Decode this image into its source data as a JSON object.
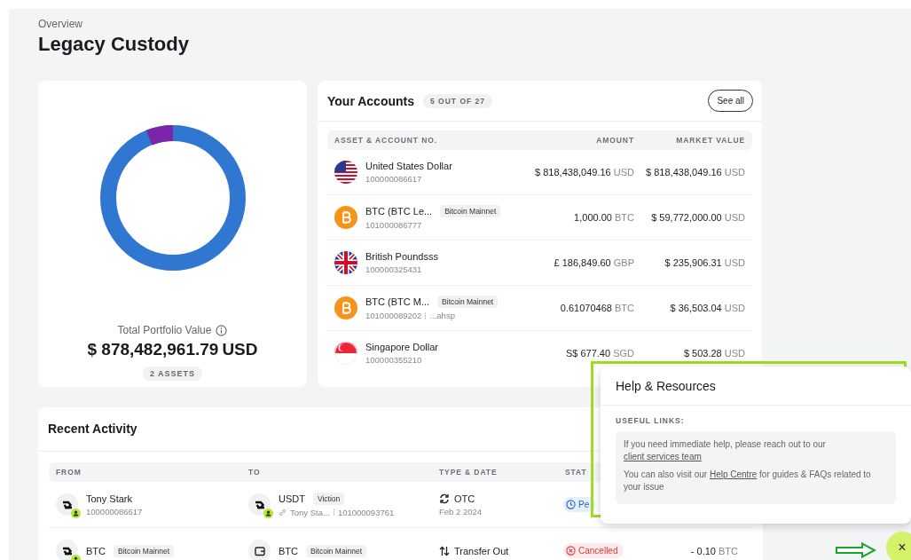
{
  "header": {
    "breadcrumb": "Overview",
    "title": "Legacy Custody"
  },
  "portfolio": {
    "label": "Total Portfolio Value",
    "value": "$ 878,482,961.79",
    "currency": "USD",
    "assets_badge": "2 ASSETS"
  },
  "accounts": {
    "title": "Your Accounts",
    "count_badge": "5 OUT OF 27",
    "see_all": "See all",
    "columns": [
      "ASSET & ACCOUNT NO.",
      "AMOUNT",
      "MARKET VALUE"
    ],
    "rows": [
      {
        "kind": "us",
        "name": "United States Dollar",
        "number": "100000086617",
        "amount": "$ 818,438,049.16",
        "amount_unit": "USD",
        "value": "$ 818,438,049.16",
        "value_unit": "USD"
      },
      {
        "kind": "btc",
        "name": "BTC (BTC Le...",
        "network": "Bitcoin Mainnet",
        "number": "101000086777",
        "amount": "1,000.00",
        "amount_unit": "BTC",
        "value": "$ 59,772,000.00",
        "value_unit": "USD"
      },
      {
        "kind": "gb",
        "name": "British Poundsss",
        "number": "100000325431",
        "amount": "£ 186,849.60",
        "amount_unit": "GBP",
        "value": "$ 235,906.31",
        "value_unit": "USD"
      },
      {
        "kind": "btc",
        "name": "BTC (BTC M...",
        "network": "Bitcoin Mainnet",
        "number": "101000089202",
        "address": "...ahsp",
        "amount": "0.61070468",
        "amount_unit": "BTC",
        "value": "$ 36,503.04",
        "value_unit": "USD"
      },
      {
        "kind": "sg",
        "name": "Singapore Dollar",
        "number": "100000355210",
        "amount": "S$ 677.40",
        "amount_unit": "SGD",
        "value": "$ 503.28",
        "value_unit": "USD"
      }
    ]
  },
  "activity": {
    "title": "Recent Activity",
    "columns": [
      "FROM",
      "TO",
      "TYPE & DATE",
      "STAT"
    ],
    "rows": [
      {
        "from": {
          "kind": "swap",
          "user_badge": true,
          "name": "Tony Stark",
          "number": "100000086617"
        },
        "to": {
          "kind": "swap",
          "user_badge": true,
          "name": "USDT",
          "network": "Viction",
          "holder": "Tony Sta...",
          "number": "101000093761"
        },
        "type": {
          "kind": "otc",
          "label": "OTC",
          "date": "Feb 2 2024"
        },
        "status": {
          "kind": "pending",
          "label": "Pe"
        }
      },
      {
        "from": {
          "kind": "swap",
          "user_badge": true,
          "name": "BTC",
          "network": "Bitcoin Mainnet"
        },
        "to": {
          "kind": "wallet",
          "user_badge": false,
          "name": "BTC",
          "network": "Bitcoin Mainnet"
        },
        "type": {
          "kind": "transfer_out",
          "label": "Transfer Out"
        },
        "status": {
          "kind": "cancelled",
          "label": "Cancelled"
        },
        "amount": "- 0.10",
        "amount_unit": "BTC"
      }
    ]
  },
  "help": {
    "title": "Help & Resources",
    "section": "USEFUL LINKS:",
    "paragraphs": [
      [
        {
          "text": "If you need immediate help, please reach out to our "
        },
        {
          "link": "client services team"
        }
      ],
      [
        {
          "text": "You can also visit our "
        },
        {
          "link": "Help Centre"
        },
        {
          "text": " for guides & FAQs related to your issue"
        }
      ]
    ]
  },
  "close_button": {
    "label": "×"
  }
}
